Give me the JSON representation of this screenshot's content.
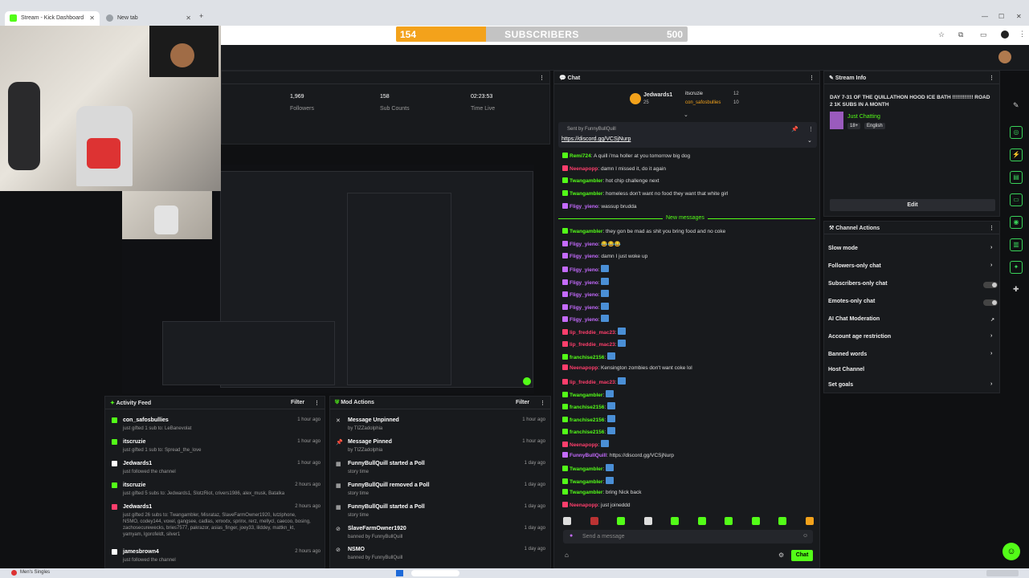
{
  "browser": {
    "tabs": [
      {
        "label": "Stream - Kick Dashboard"
      },
      {
        "label": "New tab"
      }
    ]
  },
  "subscriber_goal": {
    "current": "154",
    "label": "SUBSCRIBERS",
    "target": "500",
    "progress": 0.308
  },
  "stats": [
    {
      "value": "1,969",
      "label": "Followers"
    },
    {
      "value": "158",
      "label": "Sub Counts"
    },
    {
      "value": "02:23:53",
      "label": "Time Live"
    }
  ],
  "activity_feed": {
    "title": "Activity Feed",
    "filter": "Filter",
    "items": [
      {
        "name": "con_safosbullies",
        "desc": "just gifted 1 sub to: LeBanevolat",
        "time": "1 hour ago"
      },
      {
        "name": "itscruzie",
        "desc": "just gifted 1 sub to: Spread_the_love",
        "time": "1 hour ago"
      },
      {
        "name": "Jedwards1",
        "desc": "just followed the channel",
        "time": "1 hour ago"
      },
      {
        "name": "itscruzie",
        "desc": "just gifted 5 subs to: Jedwards1, SlotzRiot, crivers1986, alex_musk, Batalka",
        "time": "2 hours ago"
      },
      {
        "name": "Jedwards1",
        "desc": "just gifted 26 subs to: Twangambler, Misrataz, SlaveFarmOwner1920, lutziphone, NSMO, codey144, voxel, gangsee, cadlas, xmxxtx, sprinx, rerz, mellycl, caecoo, bosing, zachosecurewecks, bries7577, pakrazor, asias_finger, joey33, lilddey, mattkn_kt, yamyam, lgorofeldt, silver1",
        "time": "2 hours ago"
      },
      {
        "name": "jamesbrown4",
        "desc": "just followed the channel",
        "time": "2 hours ago"
      }
    ]
  },
  "mod_actions": {
    "title": "Mod Actions",
    "filter": "Filter",
    "items": [
      {
        "name": "Message Unpinned",
        "desc": "by TIZZadolphia",
        "time": "1 hour ago"
      },
      {
        "name": "Message Pinned",
        "desc": "by TIZZadolphia",
        "time": "1 hour ago"
      },
      {
        "name": "FunnyBullQuill started a Poll",
        "desc": "story time",
        "time": "1 day ago"
      },
      {
        "name": "FunnyBullQuill removed a Poll",
        "desc": "story time",
        "time": "1 day ago"
      },
      {
        "name": "FunnyBullQuill started a Poll",
        "desc": "story time",
        "time": "1 day ago"
      },
      {
        "name": "SlaveFarmOwner1920",
        "desc": "banned by FunnyBullQuill",
        "time": "1 day ago"
      },
      {
        "name": "NSMO",
        "desc": "banned by FunnyBullQuill",
        "time": "1 day ago"
      }
    ]
  },
  "chat": {
    "title": "Chat",
    "top_gifters": [
      {
        "name": "Jedwards1",
        "count": "25"
      },
      {
        "name": "itscruzie",
        "count": "12"
      },
      {
        "name": "con_safosbullies",
        "count": "10"
      }
    ],
    "pinned_by": "Sent by FunnyBullQuill",
    "pinned_link": "https://discord.gg/VCSjNurp",
    "new_messages_label": "New messages",
    "messages": [
      {
        "user": "Remi724",
        "color": "#53fc18",
        "text": "A quill i'ma holler at you tomorrow big dog"
      },
      {
        "user": "Neenapopp",
        "color": "#ff3e6c",
        "text": "damn I missed it, do it again"
      },
      {
        "user": "Twangambler",
        "color": "#53fc18",
        "text": "hot chip challenge next"
      },
      {
        "user": "Twangambler",
        "color": "#53fc18",
        "text": "homeless don't want no food they want that white girl"
      },
      {
        "user": "Fligy_yieno",
        "color": "#c56bff",
        "text": "wassup brudda"
      },
      {
        "user": "Twangambler",
        "color": "#53fc18",
        "text": "they gon be mad as shit you bring food and no coke"
      },
      {
        "user": "Fligy_yieno",
        "color": "#c56bff",
        "text": "😂😂😂"
      },
      {
        "user": "Fligy_yieno",
        "color": "#c56bff",
        "text": "damn I just woke up"
      },
      {
        "user": "Fligy_yieno",
        "color": "#c56bff",
        "text": ""
      },
      {
        "user": "Fligy_yieno",
        "color": "#c56bff",
        "text": ""
      },
      {
        "user": "Fligy_yieno",
        "color": "#c56bff",
        "text": ""
      },
      {
        "user": "Fligy_yieno",
        "color": "#c56bff",
        "text": ""
      },
      {
        "user": "Fligy_yieno",
        "color": "#c56bff",
        "text": ""
      },
      {
        "user": "lip_freddie_mac23",
        "color": "#ff3e6c",
        "text": ""
      },
      {
        "user": "lip_freddie_mac23",
        "color": "#ff3e6c",
        "text": ""
      },
      {
        "user": "franchise2156",
        "color": "#53fc18",
        "text": ""
      },
      {
        "user": "Neenapopp",
        "color": "#ff3e6c",
        "text": "Kensington zombies don't want coke lol"
      },
      {
        "user": "lip_freddie_mac23",
        "color": "#ff3e6c",
        "text": ""
      },
      {
        "user": "Twangambler",
        "color": "#53fc18",
        "text": ""
      },
      {
        "user": "franchise2156",
        "color": "#53fc18",
        "text": ""
      },
      {
        "user": "franchise2156",
        "color": "#53fc18",
        "text": ""
      },
      {
        "user": "franchise2156",
        "color": "#53fc18",
        "text": ""
      },
      {
        "user": "Neenapopp",
        "color": "#ff3e6c",
        "text": ""
      },
      {
        "user": "FunnyBullQuill",
        "color": "#c56bff",
        "text": "https://discord.gg/VCSjNurp"
      },
      {
        "user": "Twangambler",
        "color": "#53fc18",
        "text": ""
      },
      {
        "user": "Twangambler",
        "color": "#53fc18",
        "text": ""
      },
      {
        "user": "Twangambler",
        "color": "#53fc18",
        "text": "bring Nick back"
      },
      {
        "user": "Neenapopp",
        "color": "#ff3e6c",
        "text": "just joineddd"
      }
    ],
    "input_placeholder": "Send a message",
    "send_label": "Chat"
  },
  "stream_info": {
    "title": "Stream Info",
    "stream_title": "DAY 7-31 OF THE QUILLATHON HOOD ICE BATH !!!!!!!!!!!! ROAD 2 1K SUBS IN A MONTH",
    "category": "Just Chatting",
    "tags": [
      "18+",
      "English"
    ],
    "edit_label": "Edit"
  },
  "channel_actions": {
    "title": "Channel Actions",
    "items": [
      {
        "label": "Slow mode",
        "control": "arrow"
      },
      {
        "label": "Followers-only chat",
        "control": "arrow"
      },
      {
        "label": "Subscribers-only chat",
        "control": "toggle"
      },
      {
        "label": "Emotes-only chat",
        "control": "toggle"
      },
      {
        "label": "AI Chat Moderation",
        "control": "external"
      },
      {
        "label": "Account age restriction",
        "control": "arrow"
      },
      {
        "label": "Banned words",
        "control": "arrow"
      },
      {
        "label": "Host Channel",
        "control": "none"
      },
      {
        "label": "Set goals",
        "control": "arrow"
      }
    ]
  },
  "taskbar": {
    "left_label": "Men's Singles"
  },
  "colors": {
    "accent": "#53fc18",
    "goal": "#f3a21b",
    "panel": "#181a1d"
  }
}
